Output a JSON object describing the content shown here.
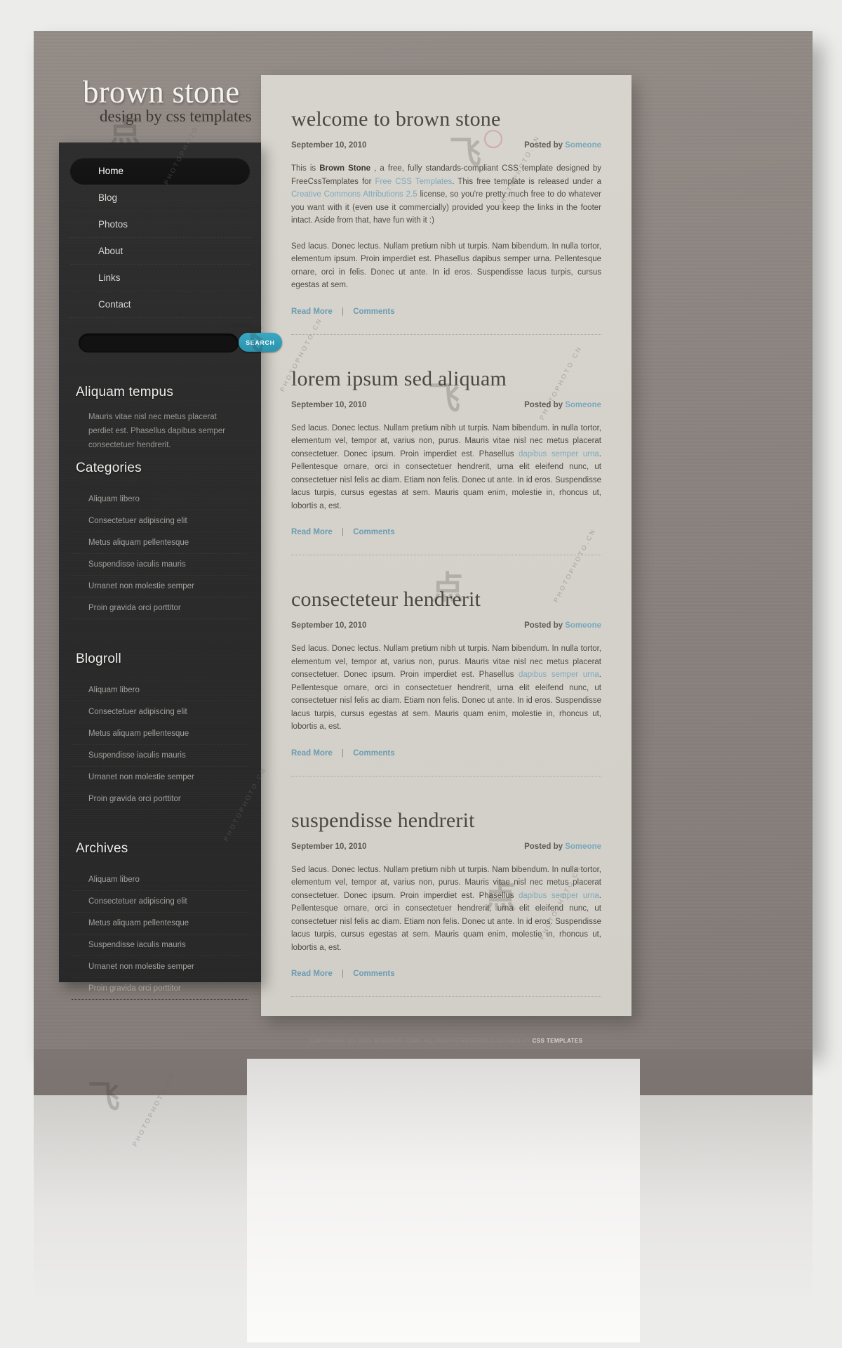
{
  "site": {
    "logo_title": "brown stone",
    "logo_subtitle": "design by css templates"
  },
  "nav": {
    "items": [
      {
        "label": "Home",
        "active": true
      },
      {
        "label": "Blog",
        "active": false
      },
      {
        "label": "Photos",
        "active": false
      },
      {
        "label": "About",
        "active": false
      },
      {
        "label": "Links",
        "active": false
      },
      {
        "label": "Contact",
        "active": false
      }
    ]
  },
  "search": {
    "value": "",
    "placeholder": "",
    "button_label": "SEARCH",
    "accent_color": "#3aa8c2"
  },
  "widgets": {
    "tempus": {
      "title": "Aliquam tempus",
      "text": "Mauris vitae nisl nec metus placerat perdiet est. Phasellus dapibus semper consectetuer hendrerit."
    },
    "categories": {
      "title": "Categories",
      "items": [
        "Aliquam libero",
        "Consectetuer adipiscing elit",
        "Metus aliquam pellentesque",
        "Suspendisse iaculis mauris",
        "Urnanet non molestie semper",
        "Proin gravida orci porttitor"
      ]
    },
    "blogroll": {
      "title": "Blogroll",
      "items": [
        "Aliquam libero",
        "Consectetuer adipiscing elit",
        "Metus aliquam pellentesque",
        "Suspendisse iaculis mauris",
        "Urnanet non molestie semper",
        "Proin gravida orci porttitor"
      ]
    },
    "archives": {
      "title": "Archives",
      "items": [
        "Aliquam libero",
        "Consectetuer adipiscing elit",
        "Metus aliquam pellentesque",
        "Suspendisse iaculis mauris",
        "Urnanet non molestie semper",
        "Proin gravida orci porttitor"
      ]
    }
  },
  "posts": [
    {
      "title": "welcome to brown stone",
      "date": "September 10, 2010",
      "posted_by_label": "Posted by",
      "author": "Someone",
      "read_more": "Read More",
      "comments": "Comments",
      "separator": "|",
      "paragraphs": [
        "intro",
        "Sed lacus. Donec lectus. Nullam pretium nibh ut turpis. Nam bibendum. In nulla tortor, elementum ipsum. Proin imperdiet est. Phasellus dapibus semper urna. Pellentesque ornare, orci in felis. Donec ut ante. In id eros. Suspendisse lacus turpis, cursus egestas at sem."
      ],
      "intro": {
        "a": "This is ",
        "bold": "Brown Stone",
        "b": " , a free, fully standards-compliant CSS template designed by FreeCssTemplates for ",
        "link1": "Free CSS Templates",
        "c": ". This free template is released under a ",
        "link2": "Creative Commons Attributions 2.5",
        "d": " license, so you're pretty much free to do whatever you want with it (even use it commercially) provided you keep the links in the footer intact. Aside from that, have fun with it :)"
      }
    },
    {
      "title": "lorem ipsum sed aliquam",
      "date": "September 10, 2010",
      "posted_by_label": "Posted by",
      "author": "Someone",
      "read_more": "Read More",
      "comments": "Comments",
      "separator": "|",
      "body_a": "Sed lacus. Donec lectus. Nullam pretium nibh ut turpis. Nam bibendum. in nulla tortor, elementum vel, tempor at, varius non, purus. Mauris vitae nisl nec metus placerat consectetuer. Donec ipsum. Proin imperdiet est. Phasellus ",
      "body_link": "dapibus semper urna",
      "body_b": ". Pellentesque ornare, orci in consectetuer hendrerit, urna elit eleifend nunc, ut consectetuer nisl felis ac diam. Etiam non felis. Donec ut ante. In id eros. Suspendisse lacus turpis, cursus egestas at sem. Mauris quam enim, molestie in, rhoncus ut, lobortis a, est."
    },
    {
      "title": "consecteteur hendrerit",
      "date": "September 10, 2010",
      "posted_by_label": "Posted by",
      "author": "Someone",
      "read_more": "Read More",
      "comments": "Comments",
      "separator": "|",
      "body_a": "Sed lacus. Donec lectus. Nullam pretium nibh ut turpis. Nam bibendum. In nulla tortor, elementum vel, tempor at, varius non, purus. Mauris vitae nisl nec metus placerat consectetuer. Donec ipsum. Proin imperdiet est. Phasellus ",
      "body_link": "dapibus semper urna",
      "body_b": ". Pellentesque ornare, orci in consectetuer hendrerit, urna elit eleifend nunc, ut consectetuer nisl felis ac diam. Etiam non felis. Donec ut ante. In id eros. Suspendisse lacus turpis, cursus egestas at sem. Mauris quam enim, molestie in, rhoncus ut, lobortis a, est."
    },
    {
      "title": "suspendisse hendrerit",
      "date": "September 10, 2010",
      "posted_by_label": "Posted by",
      "author": "Someone",
      "read_more": "Read More",
      "comments": "Comments",
      "separator": "|",
      "body_a": "Sed lacus. Donec lectus. Nullam pretium nibh ut turpis. Nam bibendum. In nulla tortor, elementum vel, tempor at, varius non, purus. Mauris vitae nisl nec metus placerat consectetuer. Donec ipsum. Proin imperdiet est. Phasellus ",
      "body_link": "dapibus semper urna",
      "body_b": ". Pellentesque ornare, orci in consectetuer hendrerit, urna elit eleifend nunc, ut consectetuer nisl felis ac diam. Etiam non felis. Donec ut ante. In id eros. Suspendisse lacus turpis, cursus egestas at sem. Mauris quam enim, molestie in, rhoncus ut, lobortis a, est."
    }
  ],
  "footer": {
    "copyright": "COPYRIGHT (C) 2009 SITENAME.COM. ALL RIGHTS RESERVED. DESIGN BY ",
    "designer": "CSS TEMPLATES"
  },
  "watermark": {
    "label": "PHOTOPHOTO.CN"
  }
}
